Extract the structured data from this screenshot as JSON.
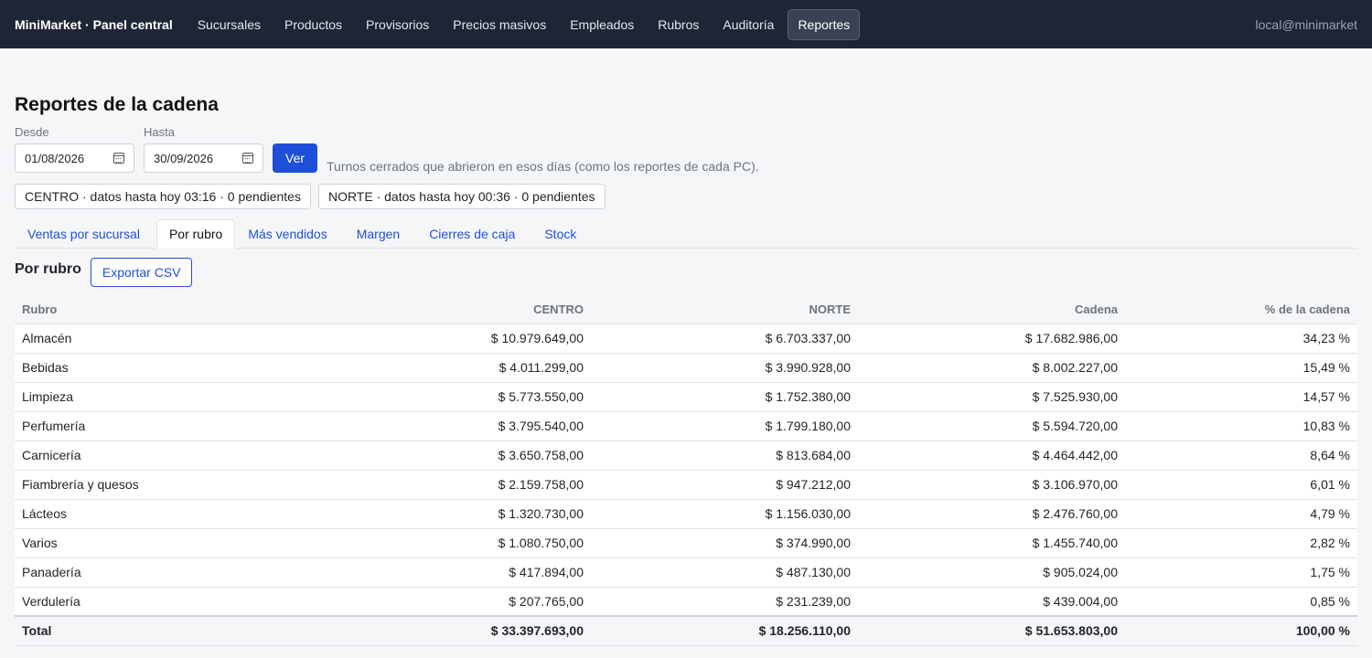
{
  "brand": "MiniMarket · Panel central",
  "nav": [
    "Sucursales",
    "Productos",
    "Provisorios",
    "Precios masivos",
    "Empleados",
    "Rubros",
    "Auditoría",
    "Reportes"
  ],
  "nav_active": "Reportes",
  "user": "local@minimarket",
  "page_title": "Reportes de la cadena",
  "filters": {
    "desde_label": "Desde",
    "desde_value": "01/08/2026",
    "hasta_label": "Hasta",
    "hasta_value": "30/09/2026",
    "ver_label": "Ver",
    "note": "Turnos cerrados que abrieron en esos días (como los reportes de cada PC)."
  },
  "status_chips": [
    "CENTRO · datos hasta hoy 03:16 · 0 pendientes",
    "NORTE · datos hasta hoy 00:36 · 0 pendientes"
  ],
  "tabs": [
    "Ventas por sucursal",
    "Por rubro",
    "Más vendidos",
    "Margen",
    "Cierres de caja",
    "Stock"
  ],
  "tab_active": "Por rubro",
  "section": {
    "title": "Por rubro",
    "export_label": "Exportar CSV"
  },
  "table": {
    "columns": [
      "Rubro",
      "CENTRO",
      "NORTE",
      "Cadena",
      "% de la cadena"
    ],
    "rows": [
      [
        "Almacén",
        "$ 10.979.649,00",
        "$ 6.703.337,00",
        "$ 17.682.986,00",
        "34,23 %"
      ],
      [
        "Bebidas",
        "$ 4.011.299,00",
        "$ 3.990.928,00",
        "$ 8.002.227,00",
        "15,49 %"
      ],
      [
        "Limpieza",
        "$ 5.773.550,00",
        "$ 1.752.380,00",
        "$ 7.525.930,00",
        "14,57 %"
      ],
      [
        "Perfumería",
        "$ 3.795.540,00",
        "$ 1.799.180,00",
        "$ 5.594.720,00",
        "10,83 %"
      ],
      [
        "Carnicería",
        "$ 3.650.758,00",
        "$ 813.684,00",
        "$ 4.464.442,00",
        "8,64 %"
      ],
      [
        "Fiambrería y quesos",
        "$ 2.159.758,00",
        "$ 947.212,00",
        "$ 3.106.970,00",
        "6,01 %"
      ],
      [
        "Lácteos",
        "$ 1.320.730,00",
        "$ 1.156.030,00",
        "$ 2.476.760,00",
        "4,79 %"
      ],
      [
        "Varios",
        "$ 1.080.750,00",
        "$ 374.990,00",
        "$ 1.455.740,00",
        "2,82 %"
      ],
      [
        "Panadería",
        "$ 417.894,00",
        "$ 487.130,00",
        "$ 905.024,00",
        "1,75 %"
      ],
      [
        "Verdulería",
        "$ 207.765,00",
        "$ 231.239,00",
        "$ 439.004,00",
        "0,85 %"
      ]
    ],
    "total": [
      "Total",
      "$ 33.397.693,00",
      "$ 18.256.110,00",
      "$ 51.653.803,00",
      "100,00 %"
    ]
  },
  "icons": {
    "date": "calendar-icon"
  },
  "colors": {
    "topbar": "#1e2636",
    "accent": "#1f4fd8"
  }
}
